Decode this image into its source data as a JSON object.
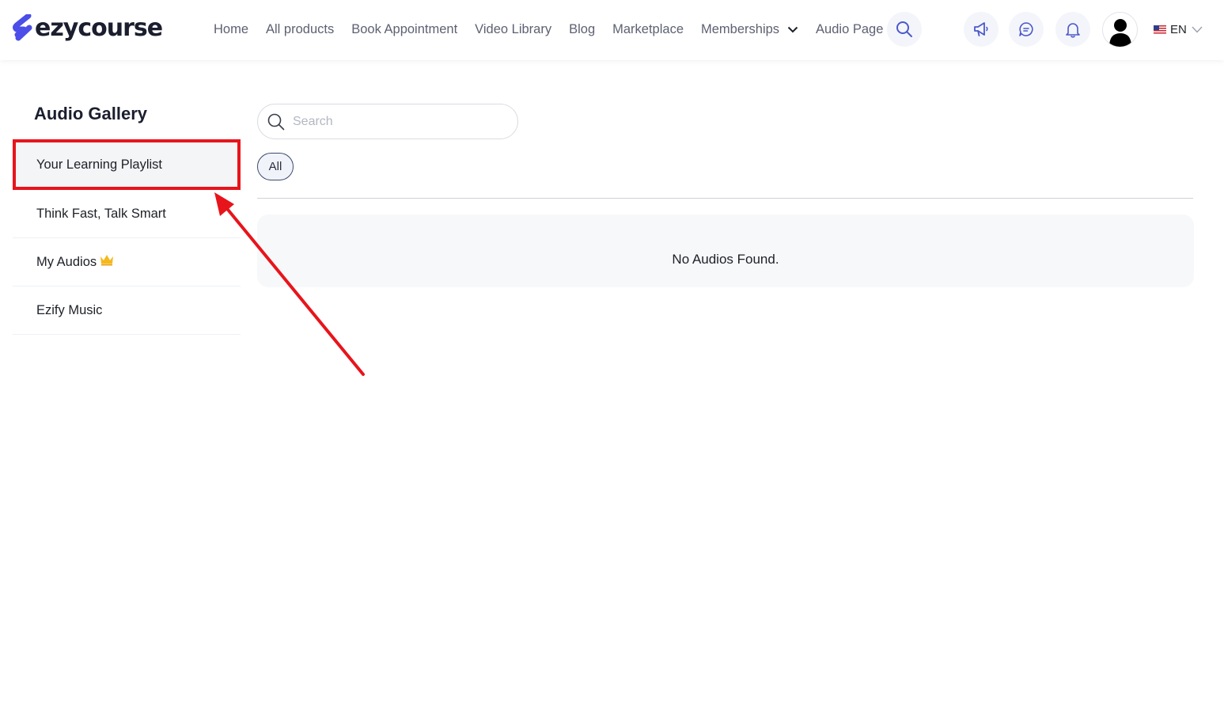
{
  "brand": {
    "name": "ezycourse",
    "accent": "#4b4ee8"
  },
  "nav": {
    "items": [
      "Home",
      "All products",
      "Book Appointment",
      "Video Library",
      "Blog",
      "Marketplace",
      "Memberships",
      "Audio Page"
    ],
    "dropdown_item": "Memberships"
  },
  "header_icons": [
    "search-icon",
    "megaphone-icon",
    "chat-icon",
    "bell-icon",
    "user-avatar"
  ],
  "language": {
    "code": "EN",
    "flag": "us-flag-icon"
  },
  "sidebar": {
    "title": "Audio Gallery",
    "items": [
      {
        "label": "Your Learning Playlist",
        "active": true
      },
      {
        "label": "Think Fast, Talk Smart"
      },
      {
        "label": "My Audios",
        "badge": "crown-icon"
      },
      {
        "label": "Ezify Music"
      }
    ]
  },
  "main": {
    "search": {
      "placeholder": "Search",
      "value": ""
    },
    "filters": [
      "All"
    ],
    "empty_message": "No Audios Found."
  },
  "annotation": {
    "color": "#e8141b",
    "target": "Your Learning Playlist"
  }
}
